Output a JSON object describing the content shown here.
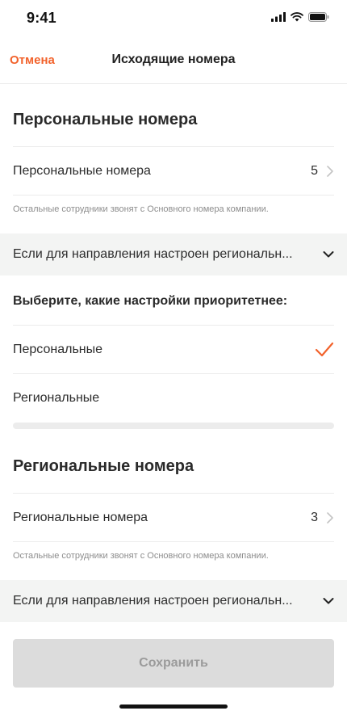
{
  "status_bar": {
    "time": "9:41"
  },
  "nav": {
    "cancel_label": "Отмена",
    "title": "Исходящие номера"
  },
  "personal": {
    "section_title": "Персональные номера",
    "row_label": "Персональные номера",
    "count": "5",
    "hint": "Остальные сотрудники звонят с Основного номера компании.",
    "dropdown_text": "Если для направления настроен региональн...",
    "priority_question": "Выберите, какие настройки приоритетнее:",
    "options": [
      {
        "label": "Персональные",
        "selected": true
      },
      {
        "label": "Региональные",
        "selected": false
      }
    ]
  },
  "regional": {
    "section_title": "Региональные номера",
    "row_label": "Региональные номера",
    "count": "3",
    "hint": "Остальные сотрудники звонят с Основного номера компании.",
    "dropdown_text": "Если для направления настроен региональн..."
  },
  "save_button": {
    "label": "Сохранить",
    "enabled": false
  },
  "colors": {
    "accent": "#f2622b",
    "disabled_button": "#dcdcdc",
    "select_bg": "#f3f4f3"
  },
  "icons": [
    "signal-icon",
    "wifi-icon",
    "battery-icon",
    "chevron-right-icon",
    "chevron-down-icon",
    "checkmark-icon"
  ]
}
